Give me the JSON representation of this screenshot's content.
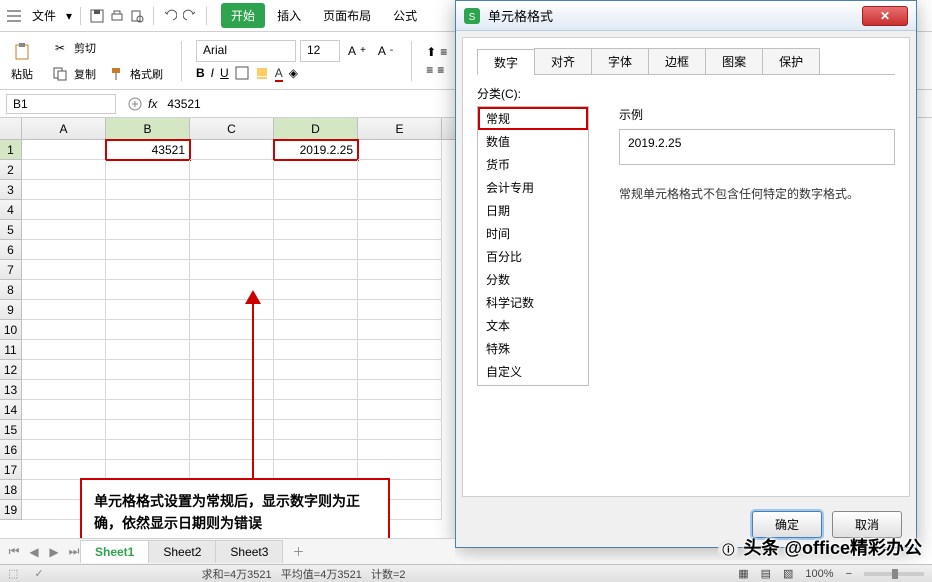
{
  "menubar": {
    "file_label": "文件",
    "tabs": [
      "开始",
      "插入",
      "页面布局",
      "公式"
    ]
  },
  "toolbar": {
    "paste_label": "粘贴",
    "cut_label": "剪切",
    "copy_label": "复制",
    "format_brush_label": "格式刷",
    "font_name": "Arial",
    "font_size": "12"
  },
  "formula_bar": {
    "name_box": "B1",
    "fx_value": "43521"
  },
  "grid": {
    "columns": [
      "A",
      "B",
      "C",
      "D",
      "E"
    ],
    "rows": 19,
    "cells": {
      "B1": "43521",
      "D1": "2019.2.25"
    }
  },
  "callout": {
    "text": "单元格格式设置为常规后，显示数字则为正确，依然显示日期则为错误"
  },
  "dialog": {
    "title": "单元格格式",
    "tabs": [
      "数字",
      "对齐",
      "字体",
      "边框",
      "图案",
      "保护"
    ],
    "category_label": "分类(C):",
    "categories": [
      "常规",
      "数值",
      "货币",
      "会计专用",
      "日期",
      "时间",
      "百分比",
      "分数",
      "科学记数",
      "文本",
      "特殊",
      "自定义"
    ],
    "example_label": "示例",
    "example_value": "2019.2.25",
    "desc": "常规单元格格式不包含任何特定的数字格式。",
    "ok_label": "确定",
    "cancel_label": "取消"
  },
  "sheet_tabs": [
    "Sheet1",
    "Sheet2",
    "Sheet3"
  ],
  "statusbar": {
    "sum": "求和=4万3521",
    "avg": "平均值=4万3521",
    "count": "计数=2",
    "zoom": "100%"
  },
  "watermark": "头条 @office精彩办公"
}
